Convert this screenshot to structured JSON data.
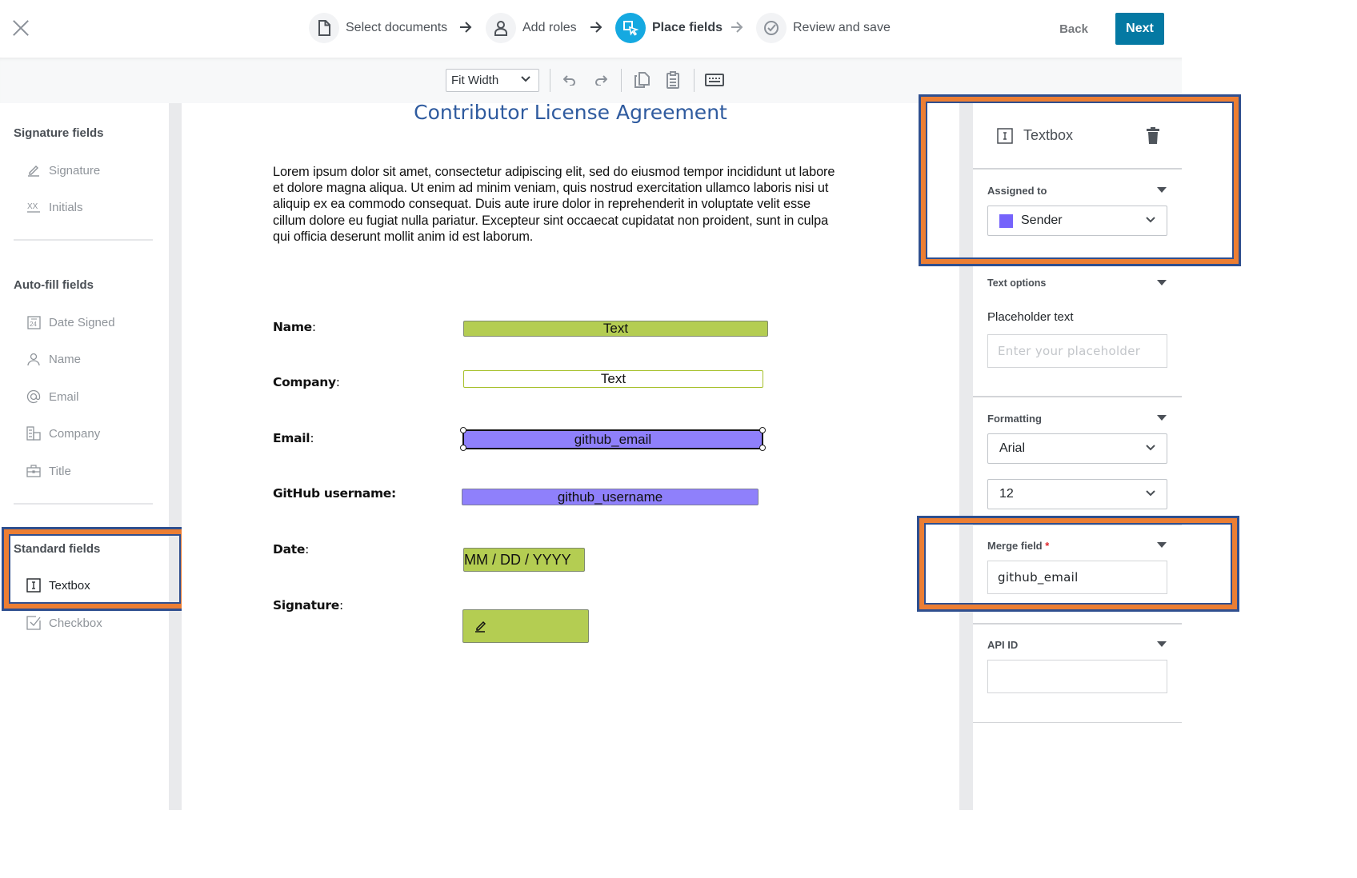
{
  "header": {
    "close_label": "Close",
    "steps": [
      {
        "label": "Select documents",
        "icon": "document-icon",
        "state": "done"
      },
      {
        "label": "Add roles",
        "icon": "person-icon",
        "state": "done"
      },
      {
        "label": "Place fields",
        "icon": "place-field-cursor-icon",
        "state": "active"
      },
      {
        "label": "Review and save",
        "icon": "check-circle-icon",
        "state": "upcoming"
      }
    ],
    "back_label": "Back",
    "next_label": "Next",
    "accent_color": "#15a9e1",
    "primary_button_color": "#0479a3"
  },
  "toolbar": {
    "zoom_value": "Fit Width",
    "icons": [
      "undo-icon",
      "redo-icon",
      "copy-icon",
      "paste-icon",
      "keyboard-icon"
    ]
  },
  "sidebar": {
    "sections": [
      {
        "title": "Signature fields",
        "items": [
          {
            "label": "Signature",
            "icon": "pen-icon"
          },
          {
            "label": "Initials",
            "icon": "initials-icon"
          }
        ]
      },
      {
        "title": "Auto-fill fields",
        "items": [
          {
            "label": "Date Signed",
            "icon": "calendar-icon"
          },
          {
            "label": "Name",
            "icon": "person-icon"
          },
          {
            "label": "Email",
            "icon": "at-icon"
          },
          {
            "label": "Company",
            "icon": "building-icon"
          },
          {
            "label": "Title",
            "icon": "briefcase-icon"
          }
        ]
      },
      {
        "title": "Standard fields",
        "items": [
          {
            "label": "Textbox",
            "icon": "textbox-icon",
            "selected": true
          },
          {
            "label": "Checkbox",
            "icon": "checkbox-icon"
          }
        ]
      }
    ]
  },
  "document": {
    "title": "Contributor License Agreement",
    "body_lines": [
      "Lorem ipsum dolor sit amet, consectetur adipiscing elit, sed do eiusmod tempor incididunt ut labore",
      "et dolore magna aliqua. Ut enim ad minim veniam, quis nostrud exercitation ullamco laboris nisi ut",
      "aliquip ex ea commodo consequat. Duis aute irure dolor in reprehenderit in voluptate velit esse",
      "cillum dolore eu fugiat nulla pariatur. Excepteur sint occaecat cupidatat non proident, sunt in culpa",
      "qui officia deserunt mollit anim id est laborum."
    ],
    "fields": [
      {
        "label": "Name",
        "value": "Text",
        "kind": "textbox",
        "color": "#b4cd52"
      },
      {
        "label": "Company",
        "value": "Text",
        "kind": "textbox",
        "color": "#ffffff"
      },
      {
        "label": "Email",
        "value": "github_email",
        "kind": "textbox",
        "color": "#8f80fb",
        "selected": true
      },
      {
        "label": "GitHub username",
        "value": "github_username",
        "kind": "textbox",
        "color": "#8f80fb"
      },
      {
        "label": "Date",
        "value": "MM / DD / YYYY",
        "kind": "date",
        "color": "#b4cd52"
      },
      {
        "label": "Signature",
        "value": "",
        "kind": "signature",
        "icon": "pen-icon",
        "color": "#b4cd52"
      }
    ]
  },
  "properties": {
    "field_type": "Textbox",
    "delete_icon": "trash-icon",
    "assigned_to": {
      "label": "Assigned to",
      "value": "Sender",
      "swatch_color": "#7563fb"
    },
    "text_options": {
      "label": "Text options",
      "placeholder_label": "Placeholder text",
      "placeholder_input_placeholder": "Enter your placeholder",
      "placeholder_value": ""
    },
    "formatting": {
      "label": "Formatting",
      "font": "Arial",
      "size": "12"
    },
    "merge_field": {
      "label": "Merge field",
      "required_mark": "*",
      "value": "github_email"
    },
    "api_id": {
      "label": "API ID",
      "value": ""
    }
  },
  "highlight_color": "#ec7e33"
}
